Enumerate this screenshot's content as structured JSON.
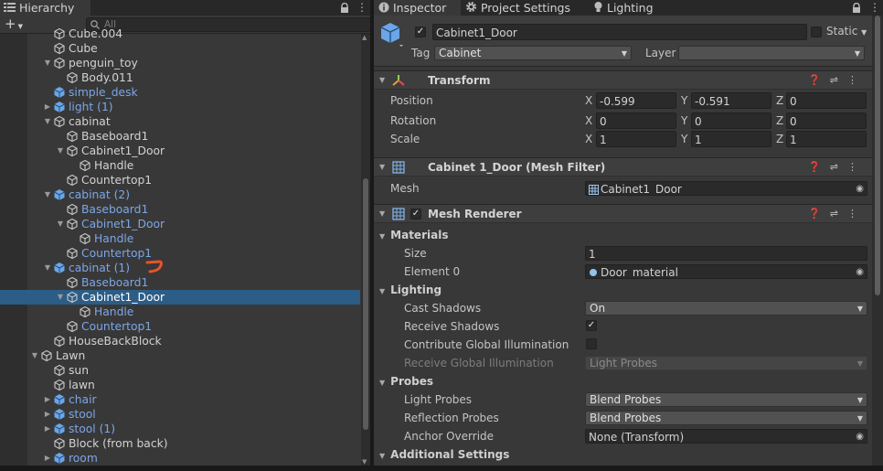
{
  "hierarchy": {
    "tab_label": "Hierarchy",
    "add_label": "+",
    "search_placeholder": "All",
    "rows": [
      {
        "label": "Cube.004",
        "depth": 2,
        "arrow": "",
        "icon": "cube",
        "prefab": false,
        "selected": false
      },
      {
        "label": "Cube",
        "depth": 2,
        "arrow": "",
        "icon": "cube",
        "prefab": false,
        "selected": false
      },
      {
        "label": "penguin_toy",
        "depth": 2,
        "arrow": "▼",
        "icon": "cube",
        "prefab": false,
        "selected": false
      },
      {
        "label": "Body.011",
        "depth": 3,
        "arrow": "",
        "icon": "cube",
        "prefab": false,
        "selected": false
      },
      {
        "label": "simple_desk",
        "depth": 2,
        "arrow": "",
        "icon": "prefab",
        "prefab": true,
        "selected": false
      },
      {
        "label": "light (1)",
        "depth": 2,
        "arrow": "▶",
        "icon": "prefab",
        "prefab": true,
        "selected": false
      },
      {
        "label": "cabinat",
        "depth": 2,
        "arrow": "▼",
        "icon": "cube",
        "prefab": false,
        "selected": false
      },
      {
        "label": "Baseboard1",
        "depth": 3,
        "arrow": "",
        "icon": "cube",
        "prefab": false,
        "selected": false
      },
      {
        "label": "Cabinet1_Door",
        "depth": 3,
        "arrow": "▼",
        "icon": "cube",
        "prefab": false,
        "selected": false
      },
      {
        "label": "Handle",
        "depth": 4,
        "arrow": "",
        "icon": "cube",
        "prefab": false,
        "selected": false
      },
      {
        "label": "Countertop1",
        "depth": 3,
        "arrow": "",
        "icon": "cube",
        "prefab": false,
        "selected": false
      },
      {
        "label": "cabinat (2)",
        "depth": 2,
        "arrow": "▼",
        "icon": "prefab",
        "prefab": true,
        "selected": false
      },
      {
        "label": "Baseboard1",
        "depth": 3,
        "arrow": "",
        "icon": "cube",
        "prefab": true,
        "selected": false
      },
      {
        "label": "Cabinet1_Door",
        "depth": 3,
        "arrow": "▼",
        "icon": "cube",
        "prefab": true,
        "selected": false
      },
      {
        "label": "Handle",
        "depth": 4,
        "arrow": "",
        "icon": "cube",
        "prefab": true,
        "selected": false
      },
      {
        "label": "Countertop1",
        "depth": 3,
        "arrow": "",
        "icon": "cube",
        "prefab": true,
        "selected": false
      },
      {
        "label": "cabinat (1)",
        "depth": 2,
        "arrow": "▼",
        "icon": "prefab",
        "prefab": true,
        "selected": false
      },
      {
        "label": "Baseboard1",
        "depth": 3,
        "arrow": "",
        "icon": "cube",
        "prefab": true,
        "selected": false
      },
      {
        "label": "Cabinet1_Door",
        "depth": 3,
        "arrow": "▼",
        "icon": "cube",
        "prefab": false,
        "selected": true
      },
      {
        "label": "Handle",
        "depth": 4,
        "arrow": "",
        "icon": "cube",
        "prefab": true,
        "selected": false
      },
      {
        "label": "Countertop1",
        "depth": 3,
        "arrow": "",
        "icon": "cube",
        "prefab": true,
        "selected": false
      },
      {
        "label": "HouseBackBlock",
        "depth": 2,
        "arrow": "",
        "icon": "cube",
        "prefab": false,
        "selected": false
      },
      {
        "label": "Lawn",
        "depth": 1,
        "arrow": "▼",
        "icon": "cube",
        "prefab": false,
        "selected": false
      },
      {
        "label": "sun",
        "depth": 2,
        "arrow": "",
        "icon": "cube",
        "prefab": false,
        "selected": false
      },
      {
        "label": "lawn",
        "depth": 2,
        "arrow": "",
        "icon": "cube",
        "prefab": false,
        "selected": false
      },
      {
        "label": "chair",
        "depth": 2,
        "arrow": "▶",
        "icon": "prefab",
        "prefab": true,
        "selected": false
      },
      {
        "label": "stool",
        "depth": 2,
        "arrow": "▶",
        "icon": "prefab",
        "prefab": true,
        "selected": false
      },
      {
        "label": "stool (1)",
        "depth": 2,
        "arrow": "▶",
        "icon": "prefab",
        "prefab": true,
        "selected": false
      },
      {
        "label": "Block (from back)",
        "depth": 2,
        "arrow": "",
        "icon": "cube",
        "prefab": false,
        "selected": false
      },
      {
        "label": "room",
        "depth": 2,
        "arrow": "▶",
        "icon": "prefab",
        "prefab": true,
        "selected": false
      }
    ]
  },
  "tabs": {
    "inspector": "Inspector",
    "project_settings": "Project Settings",
    "lighting": "Lighting"
  },
  "object": {
    "name": "Cabinet1_Door",
    "static_label": "Static",
    "tag_label": "Tag",
    "tag_value": "Cabinet",
    "layer_label": "Layer",
    "layer_value": ""
  },
  "transform": {
    "title": "Transform",
    "rows": [
      {
        "label": "Position",
        "x": "-0.599",
        "y": "-0.591",
        "z": "0"
      },
      {
        "label": "Rotation",
        "x": "0",
        "y": "0",
        "z": "0"
      },
      {
        "label": "Scale",
        "x": "1",
        "y": "1",
        "z": "1"
      }
    ]
  },
  "mesh_filter": {
    "title": "Cabinet 1_Door (Mesh Filter)",
    "mesh_label": "Mesh",
    "mesh_value": "Cabinet1_Door"
  },
  "mesh_renderer": {
    "title": "Mesh Renderer",
    "materials_label": "Materials",
    "size_label": "Size",
    "size_value": "1",
    "element0_label": "Element 0",
    "element0_value": "Door_material",
    "lighting_label": "Lighting",
    "cast_shadows_label": "Cast Shadows",
    "cast_shadows_value": "On",
    "receive_shadows_label": "Receive Shadows",
    "contribute_gi_label": "Contribute Global Illumination",
    "receive_gi_label": "Receive Global Illumination",
    "receive_gi_value": "Light Probes",
    "probes_label": "Probes",
    "light_probes_label": "Light Probes",
    "light_probes_value": "Blend Probes",
    "reflection_probes_label": "Reflection Probes",
    "reflection_probes_value": "Blend Probes",
    "anchor_override_label": "Anchor Override",
    "anchor_override_value": "None (Transform)",
    "additional_settings_label": "Additional Settings"
  },
  "axis_labels": {
    "x": "X",
    "y": "Y",
    "z": "Z"
  },
  "colors": {
    "prefab_text": "#7ca6e7",
    "selection": "#2c5d87",
    "annotation": "#e8532a"
  }
}
